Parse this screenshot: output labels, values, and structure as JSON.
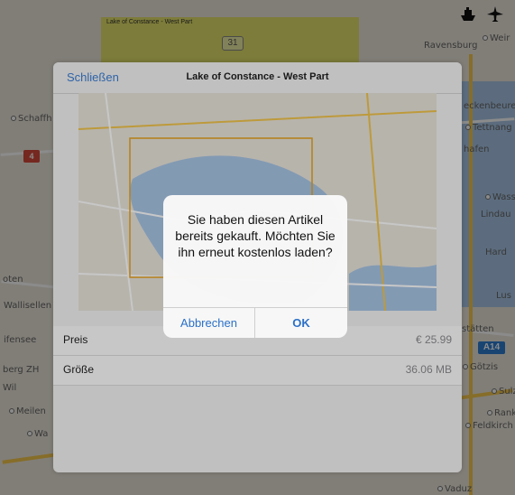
{
  "background_map": {
    "region_label": "Lake of Constance - West Part",
    "route_number": "31",
    "left_badge": "4",
    "right_badge": "A14",
    "towns": {
      "ravensburg": "Ravensburg",
      "weir": "Weir",
      "schaff": "Schaffh",
      "ecken": "eckenbeure",
      "tettnang": "Tettnang",
      "hafen": "hafen",
      "wass": "Wass",
      "lindau": "Lindau",
      "hard": "Hard",
      "oten": "oten",
      "wallisellen": "Wallisellen",
      "lustenau": "Lus",
      "ifensee": "ifensee",
      "statten": "stätten",
      "berg": "berg ZH",
      "gotzis": "Götzis",
      "wil": "Wil",
      "sulz": "Sulz",
      "meilen": "Meilen",
      "rank": "Rank",
      "wa": "Wa",
      "feldkirch": "Feldkirch",
      "vaduz": "Vaduz"
    }
  },
  "icons": {
    "ship": "ship-icon",
    "plane": "plane-icon"
  },
  "sheet": {
    "close_label": "Schließen",
    "title": "Lake of Constance - West Part",
    "rows": [
      {
        "label": "Preis",
        "value": "€ 25.99"
      },
      {
        "label": "Größe",
        "value": "36.06 MB"
      }
    ]
  },
  "alert": {
    "message": "Sie haben diesen Artikel bereits gekauft. Möchten Sie ihn erneut kostenlos laden?",
    "cancel_label": "Abbrechen",
    "ok_label": "OK"
  },
  "colors": {
    "accent": "#3b7fd6",
    "region_highlight": "#e1e146",
    "lake": "#a9c8e9",
    "badge_red": "#d94b3d",
    "badge_blue": "#2d7fd1"
  }
}
